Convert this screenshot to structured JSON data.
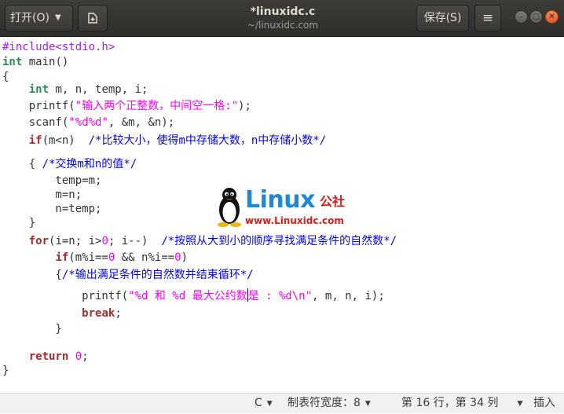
{
  "header": {
    "open_label": "打开(O)",
    "save_label": "保存(S)",
    "menu_glyph": "≡",
    "title": "*linuxidc.c",
    "subtitle": "~/linuxidc.com"
  },
  "code": {
    "lines": [
      [
        {
          "t": "#include<stdio.h>",
          "c": "pp"
        }
      ],
      [
        {
          "t": "int",
          "c": "type"
        },
        {
          "t": " main()"
        }
      ],
      [
        {
          "t": "{"
        }
      ],
      [
        {
          "t": "    "
        },
        {
          "t": "int",
          "c": "type"
        },
        {
          "t": " m, n, temp, i;"
        }
      ],
      [
        {
          "t": "    printf("
        },
        {
          "t": "\"输入两个正整数，中间空一格:\"",
          "c": "str"
        },
        {
          "t": ");"
        }
      ],
      [
        {
          "t": "    scanf("
        },
        {
          "t": "\"%d%d\"",
          "c": "str"
        },
        {
          "t": ", &m, &n);"
        }
      ],
      [
        {
          "t": "    "
        },
        {
          "t": "if",
          "c": "kw"
        },
        {
          "t": "(m<n)  "
        },
        {
          "t": "/*比较大小，使得m中存储大数，n中存储小数*/",
          "c": "com"
        }
      ],
      [
        {
          "t": "    { "
        },
        {
          "t": "/*交换m和n的值*/",
          "c": "com"
        }
      ],
      [
        {
          "t": "        temp=m;"
        }
      ],
      [
        {
          "t": "        m=n;"
        }
      ],
      [
        {
          "t": "        n=temp;"
        }
      ],
      [
        {
          "t": "    }"
        }
      ],
      [
        {
          "t": "    "
        },
        {
          "t": "for",
          "c": "kw"
        },
        {
          "t": "(i=n; i>"
        },
        {
          "t": "0",
          "c": "num"
        },
        {
          "t": "; i--)  "
        },
        {
          "t": "/*按照从大到小的顺序寻找满足条件的自然数*/",
          "c": "com"
        }
      ],
      [
        {
          "t": "        "
        },
        {
          "t": "if",
          "c": "kw"
        },
        {
          "t": "(m%i=="
        },
        {
          "t": "0",
          "c": "num"
        },
        {
          "t": " && n%i=="
        },
        {
          "t": "0",
          "c": "num"
        },
        {
          "t": ")"
        }
      ],
      [
        {
          "t": "        {"
        },
        {
          "t": "/*输出满足条件的自然数并结束循环*/",
          "c": "com"
        }
      ],
      [
        {
          "t": "            printf("
        },
        {
          "t": "\"%d 和 %d 最大公约数",
          "c": "str"
        },
        {
          "cursor": true
        },
        {
          "t": "是 : %d\\n\"",
          "c": "str"
        },
        {
          "t": ", m, n, i);"
        }
      ],
      [
        {
          "t": "            "
        },
        {
          "t": "break",
          "c": "kw"
        },
        {
          "t": ";"
        }
      ],
      [
        {
          "t": "        }"
        }
      ],
      [
        {
          "t": ""
        }
      ],
      [
        {
          "t": "    "
        },
        {
          "t": "return",
          "c": "kw"
        },
        {
          "t": " "
        },
        {
          "t": "0",
          "c": "num"
        },
        {
          "t": ";"
        }
      ],
      [
        {
          "t": "}"
        }
      ]
    ]
  },
  "watermark": {
    "brand": "Linux",
    "cn": "公社",
    "url": "www.Linuxidc.com"
  },
  "statusbar": {
    "language": "C",
    "tab_width": "制表符宽度：8",
    "position": "第 16 行，第 34 列",
    "mode": "插入"
  },
  "colors": {
    "preprocessor": "#a020f0",
    "keyword": "#a52a2a",
    "type": "#2e8b57",
    "string": "#ff00ff",
    "comment": "#0000ff",
    "watermark_blue": "#1e88d0",
    "watermark_red": "#d81d1d"
  },
  "icons": {
    "new_document": "new-document-icon",
    "menu": "hamburger-menu-icon",
    "minimize": "minimize-icon",
    "maximize": "maximize-icon",
    "close": "close-icon"
  }
}
